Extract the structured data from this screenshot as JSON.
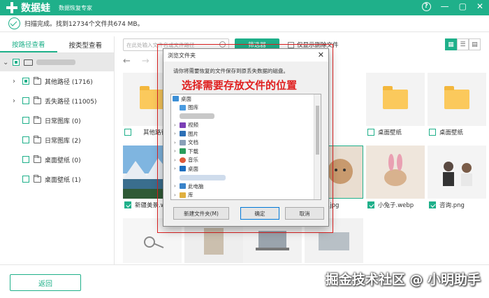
{
  "app": {
    "name": "数据蛙",
    "subtitle": "数据恢复专家",
    "help": "?",
    "min": "—",
    "max": "▢",
    "close": "✕",
    "brand_color": "#1fb08a"
  },
  "status": {
    "text": "扫描完成。找到12734个文件共674 MB。"
  },
  "sidebar": {
    "tabs": [
      {
        "label": "按路径查看"
      },
      {
        "label": "按类型查看"
      }
    ],
    "items": [
      {
        "label": "其他路径 (1716)"
      },
      {
        "label": "丢失路径 (11005)"
      },
      {
        "label": "日常图库 (0)"
      },
      {
        "label": "日常图库 (2)"
      },
      {
        "label": "桌面壁纸 (0)"
      },
      {
        "label": "桌面壁纸 (1)"
      }
    ]
  },
  "toolbar": {
    "search_placeholder": "在此处输入文件名或文件路径",
    "filter_label": "筛选器",
    "only_deleted_label": "仅显示删除文件"
  },
  "nav": {
    "back": "←",
    "forward": "→"
  },
  "grid": {
    "files": [
      {
        "label": "其他路径",
        "type": "folder"
      },
      {
        "label": "桌面壁纸",
        "type": "folder"
      },
      {
        "label": "桌面壁纸",
        "type": "folder"
      },
      {
        "label": "新疆美景.webp",
        "type": "image"
      },
      {
        "label": "猫.jpg",
        "type": "image"
      },
      {
        "label": "小兔子.webp",
        "type": "image"
      },
      {
        "label": "咨询.png",
        "type": "image"
      }
    ]
  },
  "footer": {
    "back_label": "返回",
    "watermark": "掘金技术社区 @ 小明助手"
  },
  "dialog": {
    "title": "浏览文件夹",
    "close": "✕",
    "message": "请你将需要恢复的文件保存到原丢失数据的磁盘。",
    "annotation": "选择需要存放文件的位置",
    "tree": [
      {
        "label": "桌面",
        "icon": "desktop-icon"
      },
      {
        "label": "图库",
        "icon": "gallery-icon"
      },
      {
        "label": "视频",
        "icon": "video-icon"
      },
      {
        "label": "图片",
        "icon": "picture-icon"
      },
      {
        "label": "文档",
        "icon": "document-icon"
      },
      {
        "label": "下载",
        "icon": "download-icon"
      },
      {
        "label": "音乐",
        "icon": "music-icon"
      },
      {
        "label": "桌面",
        "icon": "desktop-icon"
      },
      {
        "label": "此电脑",
        "icon": "pc-icon"
      },
      {
        "label": "库",
        "icon": "library-icon"
      }
    ],
    "new_folder_label": "新建文件夹(M)",
    "ok_label": "确定",
    "cancel_label": "取消"
  }
}
